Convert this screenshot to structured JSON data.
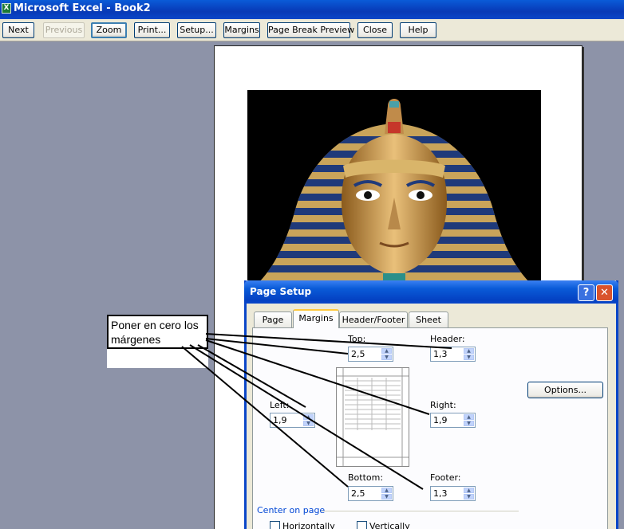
{
  "window": {
    "title": "Microsoft Excel - Book2"
  },
  "toolbar": {
    "next": "Next",
    "previous": "Previous",
    "zoom": "Zoom",
    "print": "Print...",
    "setup": "Setup...",
    "margins": "Margins",
    "page_break_preview": "Page Break Preview",
    "close": "Close",
    "help": "Help"
  },
  "preview_page": {
    "image": "pharaoh-mask-image"
  },
  "annotation": {
    "text": "Poner en cero los\nmárgenes"
  },
  "dialog": {
    "title": "Page Setup",
    "help_glyph": "?",
    "close_glyph": "✕",
    "tabs": [
      "Page",
      "Margins",
      "Header/Footer",
      "Sheet"
    ],
    "selected_tab": "Margins",
    "fields": {
      "top": {
        "label": "Top:",
        "value": "2,5"
      },
      "header": {
        "label": "Header:",
        "value": "1,3"
      },
      "left": {
        "label": "Left:",
        "value": "1,9"
      },
      "right": {
        "label": "Right:",
        "value": "1,9"
      },
      "bottom": {
        "label": "Bottom:",
        "value": "2,5"
      },
      "footer": {
        "label": "Footer:",
        "value": "1,3"
      }
    },
    "options_button": "Options...",
    "center_on_page": "Center on page",
    "horizontally": "Horizontally",
    "vertically": "Vertically"
  },
  "colors": {
    "app_background": "#8d93a8",
    "titlebar_blue": "#0a46c8",
    "dialog_face": "#ece9d8",
    "group_label_blue": "#0046d5"
  }
}
